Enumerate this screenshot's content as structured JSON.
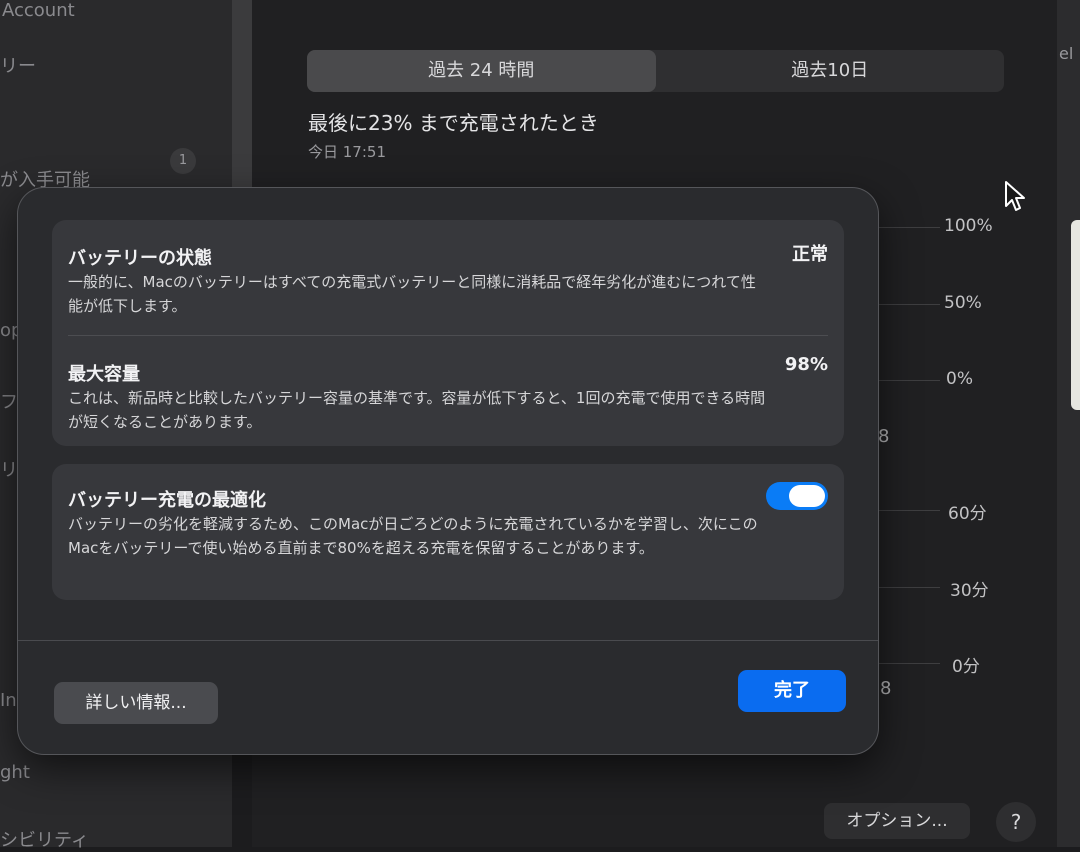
{
  "sidebar": {
    "items": [
      "Account",
      "リー",
      "が入手可能",
      "op",
      "フ",
      "リ",
      "In",
      "ght",
      "シビリティ"
    ],
    "badge": "1"
  },
  "right_strip": {
    "label": "el"
  },
  "history_tabs": [
    "過去 24 時間",
    "過去10日"
  ],
  "last_charge": {
    "heading": "最後に23% まで充電されたとき",
    "time": "今日 17:51"
  },
  "chart": {
    "level_axis": [
      "100%",
      "50%",
      "0%"
    ],
    "usage_axis": [
      "60分",
      "30分",
      "0分"
    ],
    "stray_digits": [
      "8",
      "8"
    ]
  },
  "sheet": {
    "battery_status": {
      "title": "バッテリーの状態",
      "value": "正常",
      "description": "一般的に、Macのバッテリーはすべての充電式バッテリーと同様に消耗品で経年劣化が進むにつれて性能が低下します。"
    },
    "max_capacity": {
      "title": "最大容量",
      "value": "98%",
      "description": "これは、新品時と比較したバッテリー容量の基準です。容量が低下すると、1回の充電で使用できる時間が短くなることがあります。"
    },
    "optimized_charging": {
      "title": "バッテリー充電の最適化",
      "enabled": true,
      "description": "バッテリーの劣化を軽減するため、このMacが日ごろどのように充電されているかを学習し、次にこのMacをバッテリーで使い始める直前まで80%を超える充電を保留することがあります。"
    },
    "more_info_label": "詳しい情報...",
    "done_label": "完了"
  },
  "footer": {
    "options_label": "オプション...",
    "help_label": "?"
  },
  "colors": {
    "accent": "#0a6cf0",
    "toggle_on": "#0a7cf6",
    "sheet_bg": "#2a2b2e",
    "group_bg": "#37383c"
  }
}
